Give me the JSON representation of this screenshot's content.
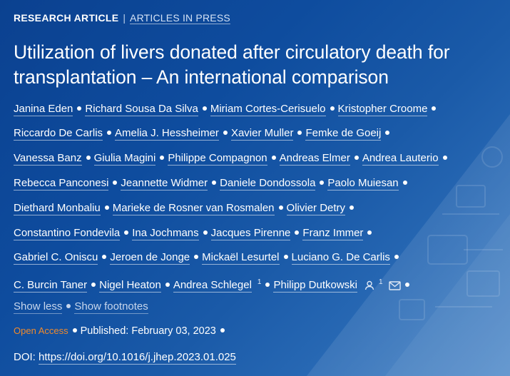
{
  "header": {
    "article_type": "RESEARCH ARTICLE",
    "separator": "|",
    "section": "ARTICLES IN PRESS"
  },
  "title": "Utilization of livers donated after circulatory death for transplantation – An international comparison",
  "author_lines": [
    [
      "Janina Eden",
      "Richard Sousa Da Silva",
      "Miriam Cortes-Cerisuelo",
      "Kristopher Croome"
    ],
    [
      "Riccardo De Carlis",
      "Amelia J. Hessheimer",
      "Xavier Muller",
      "Femke de Goeij"
    ],
    [
      "Vanessa Banz",
      "Giulia Magini",
      "Philippe Compagnon",
      "Andreas Elmer",
      "Andrea Lauterio"
    ],
    [
      "Rebecca Panconesi",
      "Jeannette Widmer",
      "Daniele Dondossola",
      "Paolo Muiesan"
    ],
    [
      "Diethard Monbaliu",
      "Marieke de Rosner van Rosmalen",
      "Olivier Detry"
    ],
    [
      "Constantino Fondevila",
      "Ina Jochmans",
      "Jacques Pirenne",
      "Franz Immer"
    ],
    [
      "Gabriel C. Oniscu",
      "Jeroen de Jonge",
      "Mickaël Lesurtel",
      "Luciano G. De Carlis"
    ],
    [
      "C. Burcin Taner",
      "Nigel Heaton",
      "Andrea Schlegel",
      "Philipp Dutkowski"
    ]
  ],
  "affiliation_marks": {
    "andrea_schlegel": "1",
    "philipp_dutkowski": "1"
  },
  "icons": {
    "person": "person-icon",
    "mail": "mail-icon"
  },
  "toggles": {
    "show_less": "Show less",
    "show_footnotes": "Show footnotes"
  },
  "meta": {
    "open_access": "Open Access",
    "published": "Published: February 03, 2023"
  },
  "doi": {
    "label": "DOI:",
    "url": "https://doi.org/10.1016/j.jhep.2023.01.025"
  },
  "colors": {
    "background": "#0e4c9e",
    "open_access": "#f08a2c",
    "text": "#ffffff"
  }
}
